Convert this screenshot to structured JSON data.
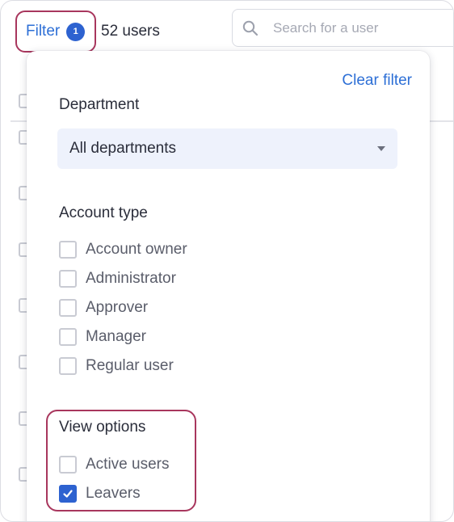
{
  "topbar": {
    "filter_label": "Filter",
    "filter_count": "1",
    "user_count": "52 users",
    "search_placeholder": "Search for a user"
  },
  "filter_panel": {
    "clear_label": "Clear filter",
    "department": {
      "title": "Department",
      "selected": "All departments"
    },
    "account_type": {
      "title": "Account type",
      "options": [
        {
          "label": "Account owner",
          "checked": false
        },
        {
          "label": "Administrator",
          "checked": false
        },
        {
          "label": "Approver",
          "checked": false
        },
        {
          "label": "Manager",
          "checked": false
        },
        {
          "label": "Regular user",
          "checked": false
        }
      ]
    },
    "view_options": {
      "title": "View options",
      "options": [
        {
          "label": "Active users",
          "checked": false
        },
        {
          "label": "Leavers",
          "checked": true
        }
      ]
    }
  },
  "colors": {
    "accent_blue": "#2d6fd6",
    "checkbox_checked": "#2d62d0",
    "highlight_outline": "#a8365d",
    "select_background": "#eef2fc"
  },
  "icons": {
    "search": "search-icon",
    "dropdown": "caret-down-icon",
    "check": "check-icon"
  }
}
